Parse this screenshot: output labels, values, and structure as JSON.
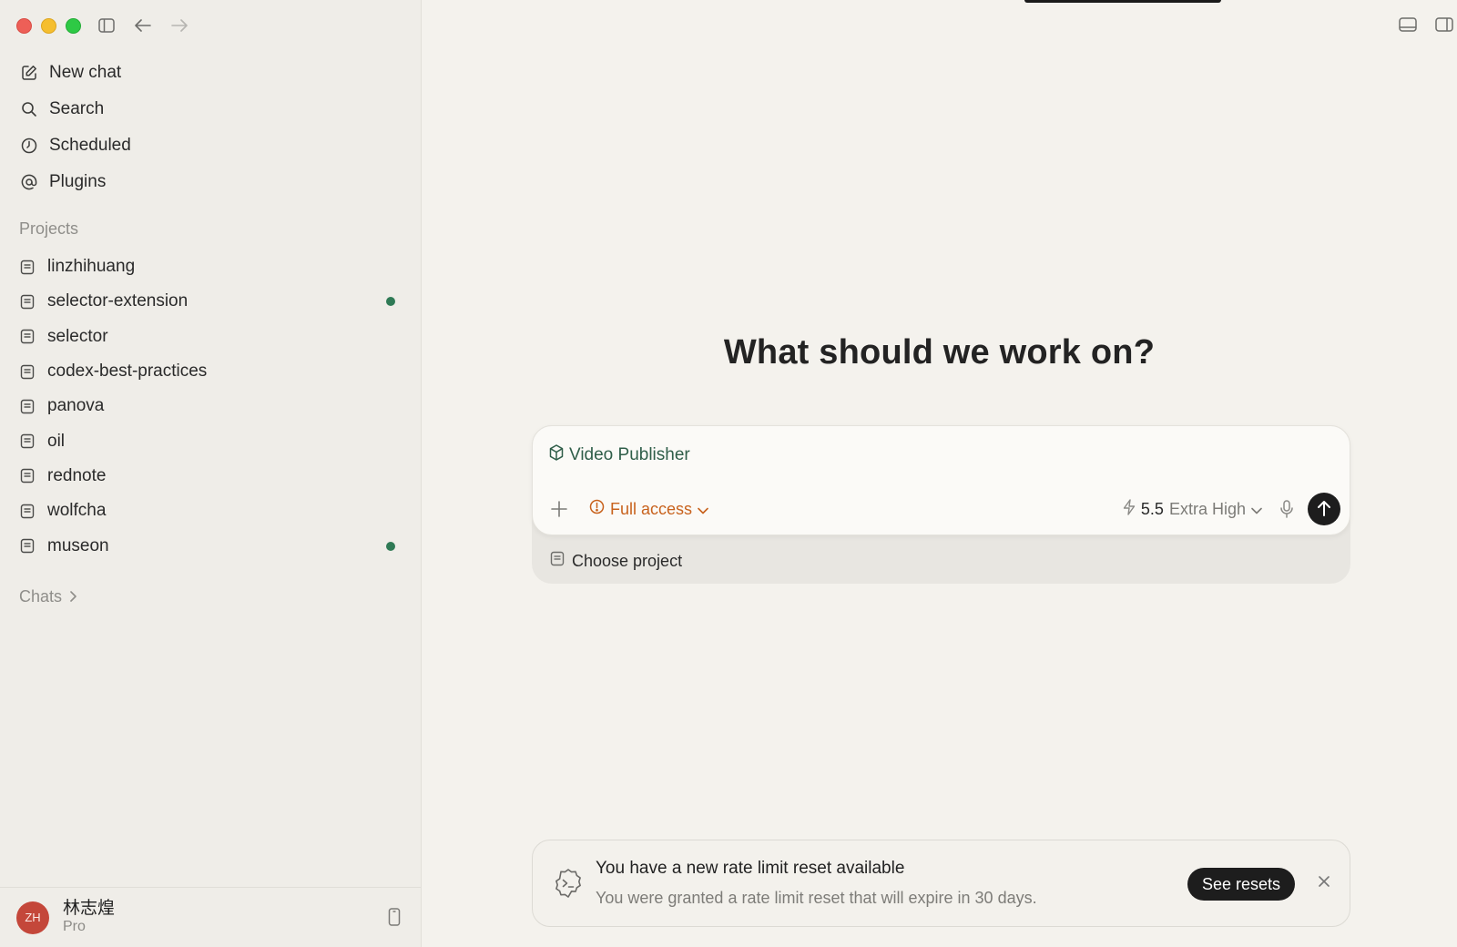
{
  "sidebar": {
    "nav": [
      {
        "label": "New chat",
        "icon": "new-chat-icon"
      },
      {
        "label": "Search",
        "icon": "search-icon"
      },
      {
        "label": "Scheduled",
        "icon": "clock-icon"
      },
      {
        "label": "Plugins",
        "icon": "at-icon"
      }
    ],
    "projects_label": "Projects",
    "projects": [
      {
        "label": "linzhihuang",
        "active": false
      },
      {
        "label": "selector-extension",
        "active": true
      },
      {
        "label": "selector",
        "active": false
      },
      {
        "label": "codex-best-practices",
        "active": false
      },
      {
        "label": "panova",
        "active": false
      },
      {
        "label": "oil",
        "active": false
      },
      {
        "label": "rednote",
        "active": false
      },
      {
        "label": "wolfcha",
        "active": false
      },
      {
        "label": "museon",
        "active": true
      }
    ],
    "chats_label": "Chats",
    "user": {
      "initials": "ZH",
      "name": "林志煌",
      "plan": "Pro"
    }
  },
  "main": {
    "heading": "What should we work on?",
    "composer": {
      "skill": "Video Publisher",
      "access": "Full access",
      "model": "5.5",
      "effort": "Extra High",
      "choose_project": "Choose project"
    },
    "notice": {
      "title": "You have a new rate limit reset available",
      "body": "You were granted a rate limit reset that will expire in 30 days.",
      "button": "See resets"
    }
  },
  "colors": {
    "accent_green": "#2f5e49",
    "active_dot": "#2f7a55",
    "access_orange": "#c8621d",
    "avatar_red": "#c4473a"
  }
}
